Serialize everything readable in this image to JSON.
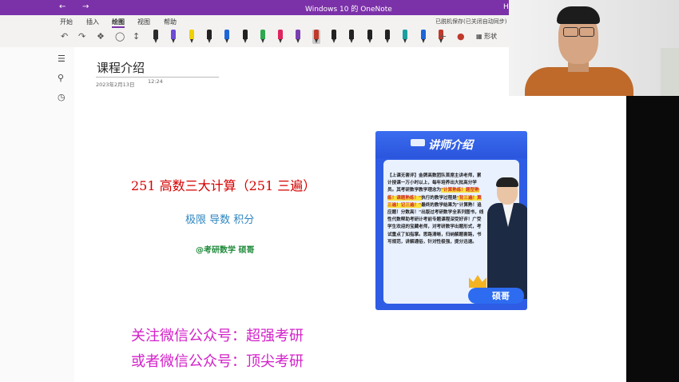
{
  "window": {
    "title": "Windows 10 的 OneNote",
    "title_tail": "H"
  },
  "ribbon": {
    "tabs": [
      "开始",
      "插入",
      "绘图",
      "视图",
      "帮助"
    ],
    "active_tab": "绘图",
    "sync_status": "已脱机保存(已关闭自动同步)"
  },
  "toolbar": {
    "shapes_label": "形状",
    "pen_colors": [
      "#2b2b2b",
      "#6f4bd6",
      "#f0d000",
      "#222222",
      "#1e66d8",
      "#222222",
      "#2fa84f",
      "#e0245e",
      "#7a3fb0",
      "#c0392b",
      "#222222",
      "#222222",
      "#222222",
      "#222222",
      "#1aa0a0",
      "#1e66d8",
      "#c0392b"
    ],
    "selected_pen_index": 9
  },
  "page": {
    "title": "课程介绍",
    "date": "2023年2月13日",
    "time": "12:24",
    "headline": "251 高数三大计算（251 三遍）",
    "topics": "极限  导数  积分",
    "handle": "@考研数学  硕哥",
    "follow_1": "关注微信公众号：超强考研",
    "follow_2": "或者微信公众号：顶尖考研"
  },
  "card": {
    "title": "讲师介绍",
    "text_before": "【上课无套评】金牌高数团队首席主讲老师，累计授课一万小时以上，每年培养出大批高分学员。其考研数学教学理念为",
    "highlight_1": "\"计算熟练！题型熟练！课题熟练！\"",
    "text_mid": "执行的教学过程是",
    "highlight_2": "\"背三遍！算三遍！记三遍！\"",
    "text_after": "最终的教学结果为\"计算熟！追应题！分数高！\"出版过考研数学全系列图书，线性代数帮助考研计考前专题课程深受好评！广受学生欢迎的宝藏老师，对考研数学出题形式，考试重点了如指掌。思路清晰，归纳解题套路，书写规范，讲解通俗，针对性极强，提分迅速。",
    "name": "硕哥"
  },
  "icons": {
    "sidebar": [
      "notebooks-icon",
      "search-icon",
      "recent-icon"
    ]
  },
  "colors": {
    "accent": "#7b31a8",
    "headline": "#d60000",
    "topics": "#2e86c1",
    "handle": "#1f8a3a",
    "follow": "#d321c9",
    "card_blue": "#2e5ce5"
  }
}
